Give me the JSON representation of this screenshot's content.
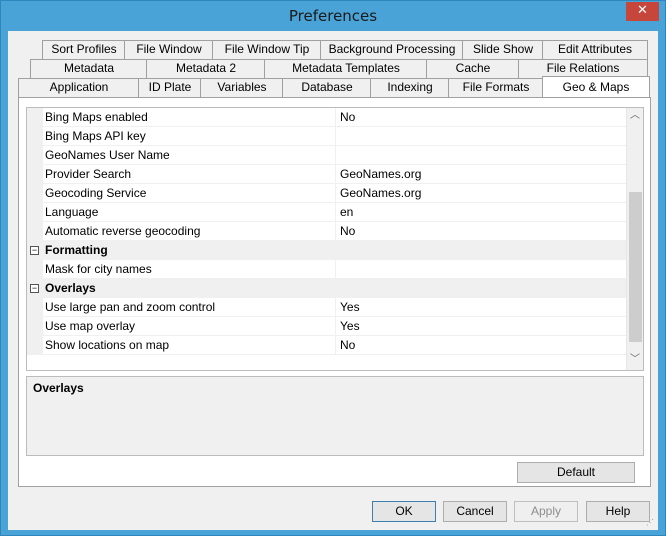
{
  "window": {
    "title": "Preferences",
    "close_glyph": "✕"
  },
  "tabs": {
    "row1": [
      "Sort Profiles",
      "File Window",
      "File Window Tip",
      "Background Processing",
      "Slide Show",
      "Edit Attributes"
    ],
    "row2": [
      "Metadata",
      "Metadata 2",
      "Metadata Templates",
      "Cache",
      "File Relations"
    ],
    "row3": [
      "Application",
      "ID Plate",
      "Variables",
      "Database",
      "Indexing",
      "File Formats",
      "Geo & Maps"
    ],
    "active": "Geo & Maps"
  },
  "grid": {
    "rows": [
      {
        "type": "prop",
        "key": "Bing Maps enabled",
        "value": "No"
      },
      {
        "type": "prop",
        "key": "Bing Maps API key",
        "value": ""
      },
      {
        "type": "prop",
        "key": "GeoNames User Name",
        "value": ""
      },
      {
        "type": "prop",
        "key": "Provider Search",
        "value": "GeoNames.org"
      },
      {
        "type": "prop",
        "key": "Geocoding Service",
        "value": "GeoNames.org"
      },
      {
        "type": "prop",
        "key": "Language",
        "value": "en"
      },
      {
        "type": "prop",
        "key": "Automatic reverse geocoding",
        "value": "No"
      },
      {
        "type": "category",
        "key": "Formatting",
        "toggle": "−"
      },
      {
        "type": "prop",
        "key": "Mask for city names",
        "value": ""
      },
      {
        "type": "category",
        "key": "Overlays",
        "toggle": "−"
      },
      {
        "type": "prop",
        "key": "Use large pan and zoom control",
        "value": "Yes"
      },
      {
        "type": "prop",
        "key": "Use map overlay",
        "value": "Yes"
      },
      {
        "type": "prop",
        "key": "Show locations on map",
        "value": "No"
      }
    ],
    "scroll_up_glyph": "︿",
    "scroll_down_glyph": "﹀"
  },
  "description": {
    "title": "Overlays"
  },
  "buttons": {
    "default": "Default",
    "ok": "OK",
    "cancel": "Cancel",
    "apply": "Apply",
    "help": "Help"
  }
}
